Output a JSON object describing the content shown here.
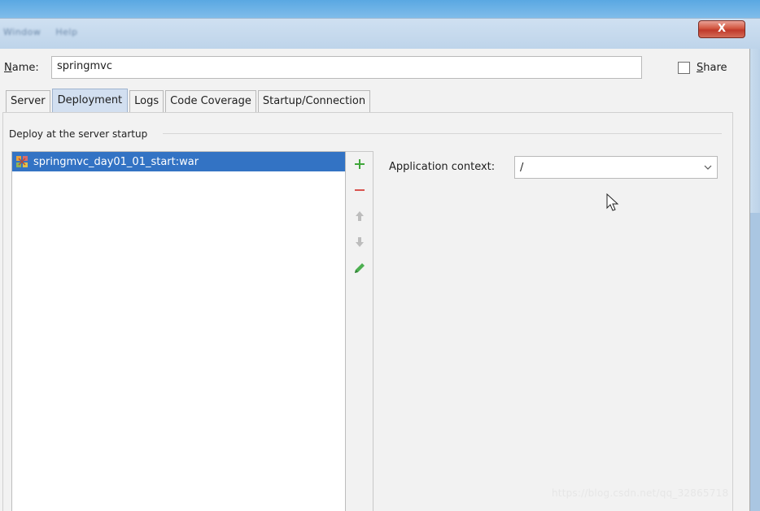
{
  "titlebar": {
    "menu_items": [
      "Window",
      "Help"
    ],
    "close_glyph": "X"
  },
  "form": {
    "name_label_prefix": "N",
    "name_label_rest": "ame:",
    "name_value": "springmvc",
    "share_label_prefix": "S",
    "share_label_rest": "hare",
    "share_checked": false
  },
  "tabs": [
    {
      "label": "Server",
      "active": false
    },
    {
      "label": "Deployment",
      "active": true
    },
    {
      "label": "Logs",
      "active": false
    },
    {
      "label": "Code Coverage",
      "active": false
    },
    {
      "label": "Startup/Connection",
      "active": false
    }
  ],
  "deploy": {
    "section_title": "Deploy at the server startup",
    "artifacts": [
      {
        "label": "springmvc_day01_01_start:war",
        "icon": "war-artifact-icon",
        "selected": true
      }
    ],
    "toolbar": [
      {
        "name": "add-icon",
        "glyph": "+",
        "color": "#3fa63a"
      },
      {
        "name": "remove-icon",
        "glyph": "−",
        "color": "#d9534f"
      },
      {
        "name": "move-up-icon",
        "glyph": "↑",
        "color": "#b5b5b5"
      },
      {
        "name": "move-down-icon",
        "glyph": "↓",
        "color": "#b5b5b5"
      },
      {
        "name": "edit-icon",
        "glyph": "✎",
        "color": "#4caf50"
      }
    ],
    "context_label": "Application context:",
    "context_value": "/"
  },
  "colors": {
    "selection": "#3373c4",
    "active_tab": "#d2dff0",
    "close_button": "#c0392b"
  },
  "watermark": "https://blog.csdn.net/qq_32865718"
}
